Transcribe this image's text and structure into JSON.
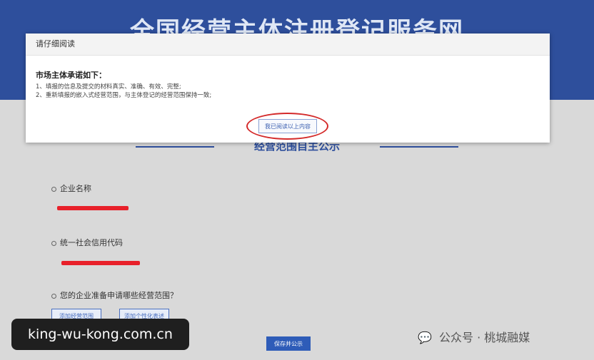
{
  "site": {
    "title": "全国经营主体注册登记服务网"
  },
  "modal": {
    "header": "请仔细阅读",
    "commit_title": "市场主体承诺如下：",
    "items": [
      "1、填报的信息及提交的材料真实、准确、有效、完整;",
      "2、重新填报的嵌入式经营范围，与主体登记的经营范围保持一致;"
    ],
    "confirm_label": "我已阅读以上内容"
  },
  "section": {
    "title": "经营范围自主公示"
  },
  "form": {
    "company_name_label": "企业名称",
    "credit_code_label": "统一社会信用代码",
    "question_label": "您的企业准备申请哪些经营范围？",
    "btn_add_scope": "添加经营范围",
    "btn_add_custom": "添加个性化表述",
    "save_label": "保存并公示"
  },
  "watermark": {
    "left": "king-wu-kong.com.cn",
    "right": "公众号 · 桃城融媒"
  },
  "colors": {
    "header_blue": "#2e4f9c",
    "redaction_red": "#e8202a",
    "highlight_circle": "#d42a2a"
  }
}
